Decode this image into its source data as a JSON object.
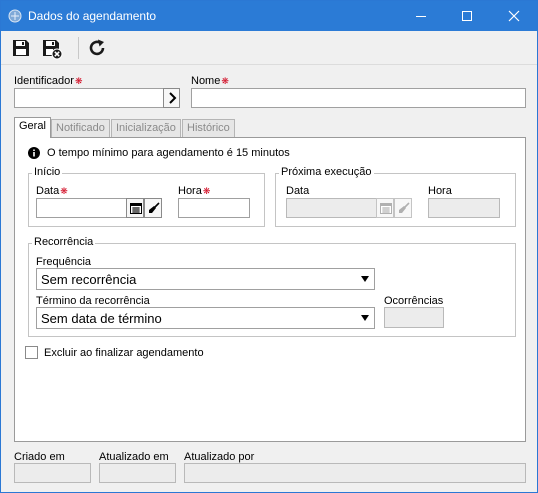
{
  "window": {
    "title": "Dados do agendamento"
  },
  "toolbar": {
    "save": "save-icon",
    "save_close": "save-and-close-icon",
    "refresh": "refresh-icon"
  },
  "fields": {
    "identificador_label": "Identificador",
    "identificador_value": "",
    "nome_label": "Nome",
    "nome_value": ""
  },
  "tabs": [
    {
      "label": "Geral",
      "active": true
    },
    {
      "label": "Notificado",
      "active": false
    },
    {
      "label": "Inicialização",
      "active": false
    },
    {
      "label": "Histórico",
      "active": false
    }
  ],
  "geral": {
    "info_text": "O tempo mínimo para agendamento é 15 minutos",
    "inicio": {
      "legend": "Início",
      "data_label": "Data",
      "data_value": "",
      "hora_label": "Hora",
      "hora_value": ""
    },
    "proxima": {
      "legend": "Próxima execução",
      "data_label": "Data",
      "hora_label": "Hora"
    },
    "recorrencia": {
      "legend": "Recorrência",
      "frequencia_label": "Frequência",
      "frequencia_value": "Sem recorrência",
      "termino_label": "Término da recorrência",
      "termino_value": "Sem data de término",
      "ocorrencias_label": "Ocorrências",
      "ocorrencias_value": ""
    },
    "excluir_label": "Excluir ao finalizar agendamento",
    "excluir_checked": false
  },
  "footer": {
    "criado_label": "Criado em",
    "atualizado_label": "Atualizado em",
    "atualizado_por_label": "Atualizado por"
  }
}
